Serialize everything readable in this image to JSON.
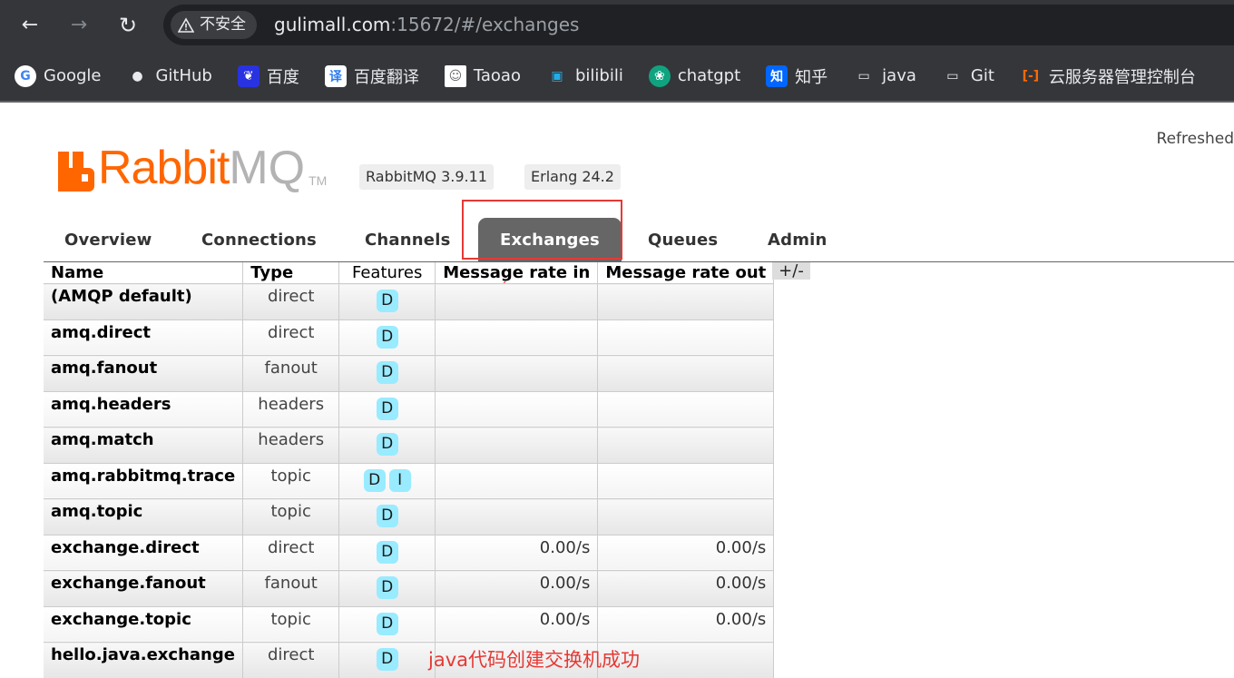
{
  "browser": {
    "security_label": "不安全",
    "url_host": "gulimall.com",
    "url_rest": ":15672/#/exchanges",
    "bookmarks": [
      {
        "label": "Google",
        "icon": "google-icon"
      },
      {
        "label": "GitHub",
        "icon": "github-icon"
      },
      {
        "label": "百度",
        "icon": "baidu-icon"
      },
      {
        "label": "百度翻译",
        "icon": "translate-icon"
      },
      {
        "label": "Taoao",
        "icon": "avatar-icon"
      },
      {
        "label": "bilibili",
        "icon": "bilibili-icon"
      },
      {
        "label": "chatgpt",
        "icon": "chatgpt-icon"
      },
      {
        "label": "知乎",
        "icon": "zhihu-icon"
      },
      {
        "label": "java",
        "icon": "folder-icon"
      },
      {
        "label": "Git",
        "icon": "folder-icon"
      },
      {
        "label": "云服务器管理控制台",
        "icon": "aliyun-icon"
      }
    ]
  },
  "header": {
    "logo_rabbit": "Rabbit",
    "logo_mq": "MQ",
    "logo_tm": "TM",
    "rabbitmq_version": "RabbitMQ 3.9.11",
    "erlang_version": "Erlang 24.2",
    "refreshed": "Refreshed"
  },
  "tabs": [
    "Overview",
    "Connections",
    "Channels",
    "Exchanges",
    "Queues",
    "Admin"
  ],
  "active_tab": "Exchanges",
  "table": {
    "columns": [
      "Name",
      "Type",
      "Features",
      "Message rate in",
      "Message rate out"
    ],
    "toggle": "+/-",
    "rows": [
      {
        "name": "(AMQP default)",
        "type": "direct",
        "features": [
          "D"
        ],
        "rate_in": "",
        "rate_out": ""
      },
      {
        "name": "amq.direct",
        "type": "direct",
        "features": [
          "D"
        ],
        "rate_in": "",
        "rate_out": ""
      },
      {
        "name": "amq.fanout",
        "type": "fanout",
        "features": [
          "D"
        ],
        "rate_in": "",
        "rate_out": ""
      },
      {
        "name": "amq.headers",
        "type": "headers",
        "features": [
          "D"
        ],
        "rate_in": "",
        "rate_out": ""
      },
      {
        "name": "amq.match",
        "type": "headers",
        "features": [
          "D"
        ],
        "rate_in": "",
        "rate_out": ""
      },
      {
        "name": "amq.rabbitmq.trace",
        "type": "topic",
        "features": [
          "D",
          "I"
        ],
        "rate_in": "",
        "rate_out": ""
      },
      {
        "name": "amq.topic",
        "type": "topic",
        "features": [
          "D"
        ],
        "rate_in": "",
        "rate_out": ""
      },
      {
        "name": "exchange.direct",
        "type": "direct",
        "features": [
          "D"
        ],
        "rate_in": "0.00/s",
        "rate_out": "0.00/s"
      },
      {
        "name": "exchange.fanout",
        "type": "fanout",
        "features": [
          "D"
        ],
        "rate_in": "0.00/s",
        "rate_out": "0.00/s"
      },
      {
        "name": "exchange.topic",
        "type": "topic",
        "features": [
          "D"
        ],
        "rate_in": "0.00/s",
        "rate_out": "0.00/s"
      },
      {
        "name": "hello.java.exchange",
        "type": "direct",
        "features": [
          "D"
        ],
        "rate_in": "",
        "rate_out": ""
      }
    ]
  },
  "annotation": {
    "text": "java代码创建交换机成功",
    "color": "#e53935"
  },
  "colors": {
    "brand_orange": "#ff6600",
    "feature_badge": "#99ebff",
    "active_tab_bg": "#666666"
  }
}
